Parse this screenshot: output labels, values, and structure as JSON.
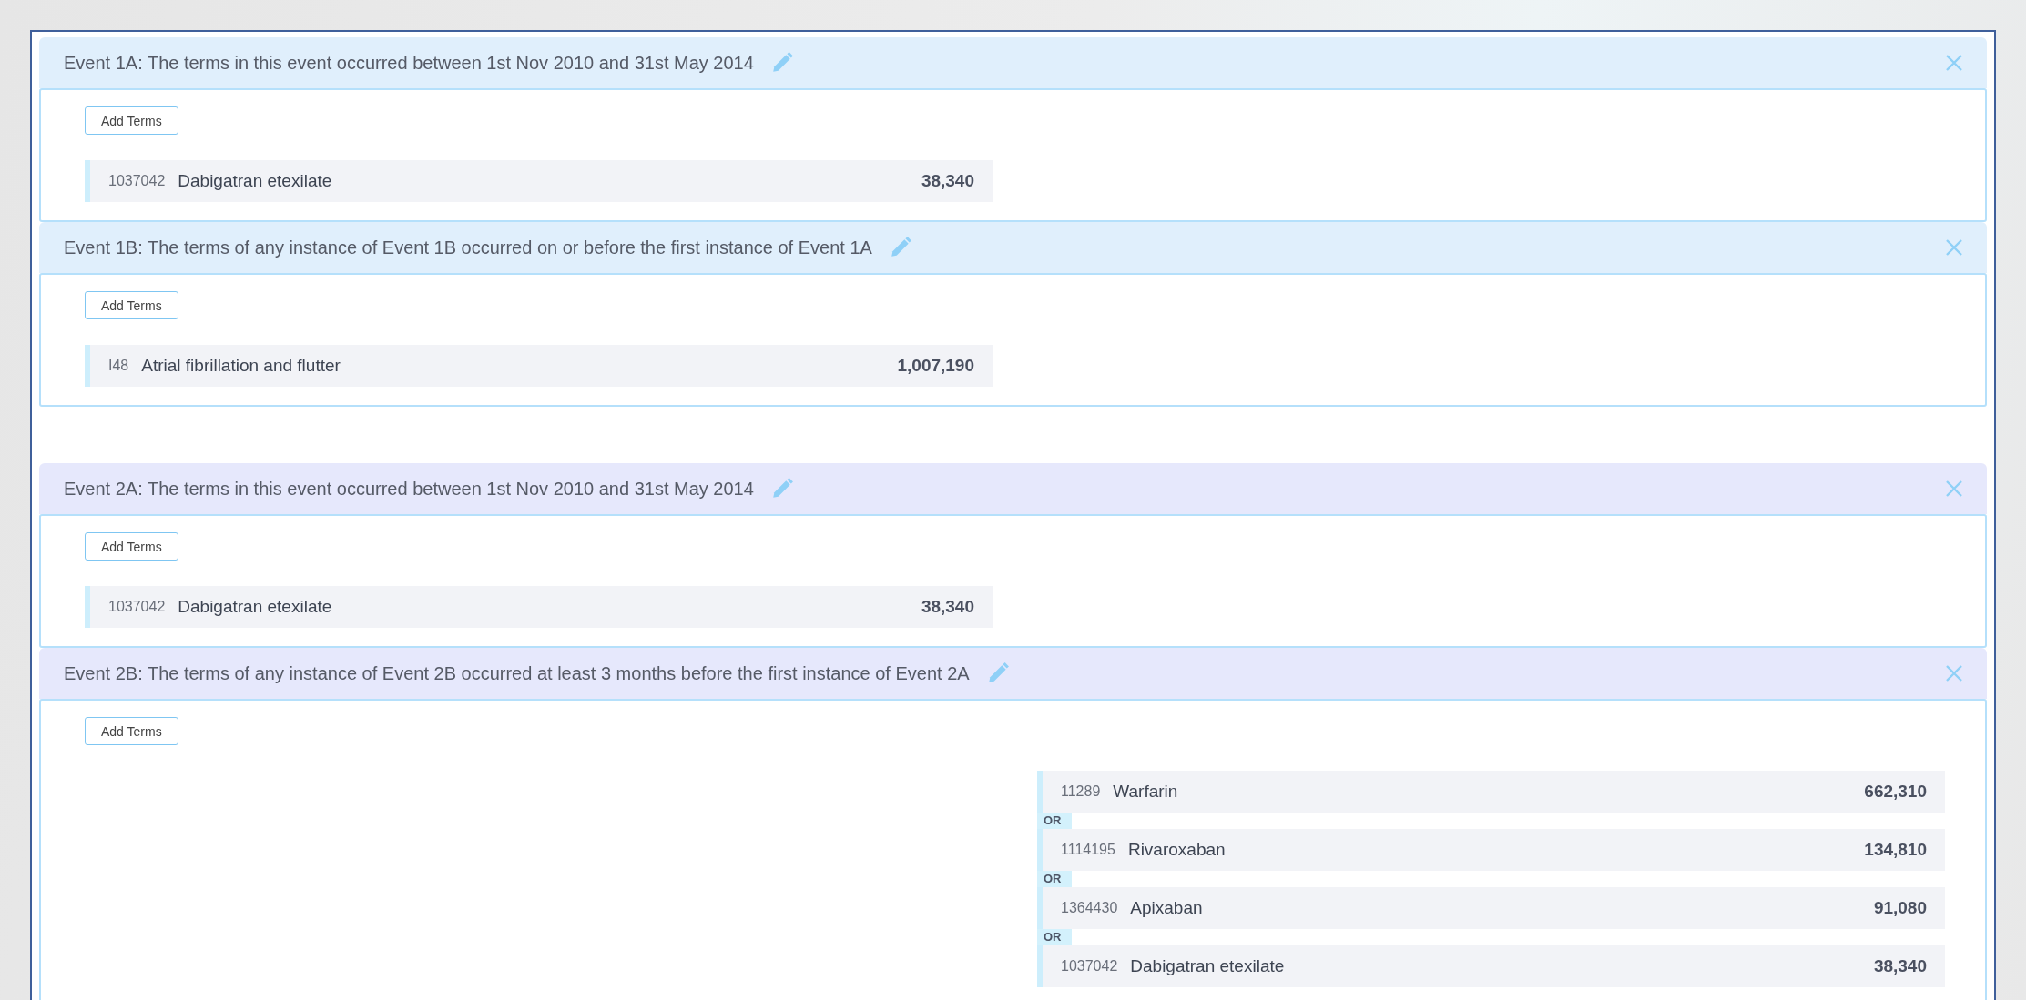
{
  "groups": [
    {
      "color": "#e0effc",
      "events": [
        {
          "title": "Event 1A: The terms in this event occurred between 1st Nov 2010 and 31st May 2014",
          "button": "Add Terms",
          "terms": [
            {
              "code": "1037042",
              "name": "Dabigatran etexilate",
              "count": "38,340"
            }
          ]
        },
        {
          "title": "Event 1B: The terms of any instance of Event 1B occurred on or before the first instance of Event 1A",
          "button": "Add Terms",
          "terms": [
            {
              "code": "I48",
              "name": "Atrial fibrillation and flutter",
              "count": "1,007,190"
            }
          ]
        }
      ]
    },
    {
      "color": "#e6e8fc",
      "events": [
        {
          "title": "Event 2A: The terms in this event occurred between 1st Nov 2010 and 31st May 2014",
          "button": "Add Terms",
          "terms": [
            {
              "code": "1037042",
              "name": "Dabigatran etexilate",
              "count": "38,340"
            }
          ]
        },
        {
          "title": "Event 2B: The terms of any instance of Event 2B occurred at least 3 months before the first instance of Event 2A",
          "button": "Add Terms",
          "terms": [
            {
              "code": "11289",
              "name": "Warfarin",
              "count": "662,310"
            },
            {
              "connector": "OR",
              "code": "1114195",
              "name": "Rivaroxaban",
              "count": "134,810"
            },
            {
              "connector": "OR",
              "code": "1364430",
              "name": "Apixaban",
              "count": "91,080"
            },
            {
              "connector": "OR",
              "code": "1037042",
              "name": "Dabigatran etexilate",
              "count": "38,340"
            }
          ]
        }
      ]
    }
  ]
}
